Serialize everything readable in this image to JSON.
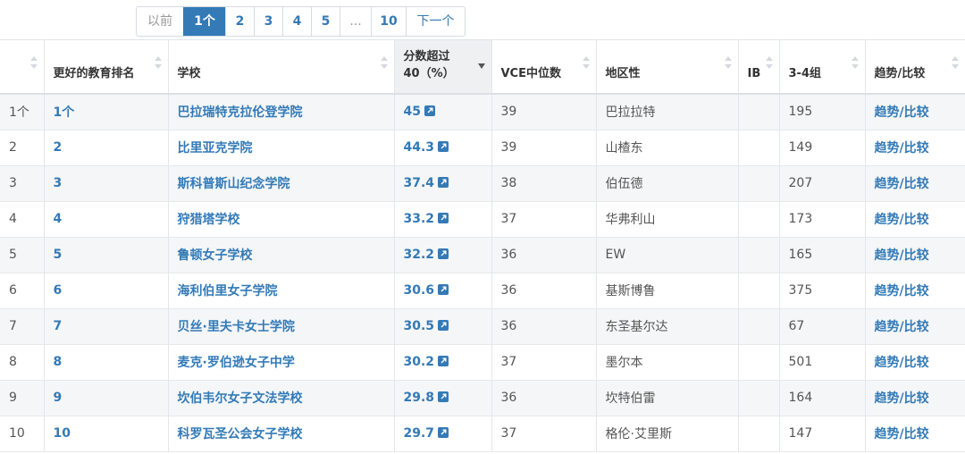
{
  "pagination": {
    "prev": "以前",
    "pages": [
      "1个",
      "2",
      "3",
      "4",
      "5",
      "...",
      "10"
    ],
    "active_index": 0,
    "next": "下一个"
  },
  "table": {
    "headers": [
      "",
      "更好的教育排名",
      "学校",
      "分数超过\n40（%）",
      "VCE中位数",
      "地区性",
      "IB",
      "3-4组",
      "趋势/比较"
    ],
    "rows": [
      [
        "1个",
        "1个",
        "巴拉瑞特克拉伦登学院",
        "45",
        "39",
        "巴拉拉特",
        "",
        "195",
        "趋势/比较"
      ],
      [
        "2",
        "2",
        "比里亚克学院",
        "44.3",
        "39",
        "山楂东",
        "",
        "149",
        "趋势/比较"
      ],
      [
        "3",
        "3",
        "斯科普斯山纪念学院",
        "37.4",
        "38",
        "伯伍德",
        "",
        "207",
        "趋势/比较"
      ],
      [
        "4",
        "4",
        "狩猎塔学校",
        "33.2",
        "37",
        "华弗利山",
        "",
        "173",
        "趋势/比较"
      ],
      [
        "5",
        "5",
        "鲁顿女子学校",
        "32.2",
        "36",
        "EW",
        "",
        "165",
        "趋势/比较"
      ],
      [
        "6",
        "6",
        "海利伯里女子学院",
        "30.6",
        "36",
        "基斯博鲁",
        "",
        "375",
        "趋势/比较"
      ],
      [
        "7",
        "7",
        "贝丝·里夫卡女士学院",
        "30.5",
        "36",
        "东圣基尔达",
        "",
        "67",
        "趋势/比较"
      ],
      [
        "8",
        "8",
        "麦克·罗伯逊女子中学",
        "30.2",
        "37",
        "墨尔本",
        "",
        "501",
        "趋势/比较"
      ],
      [
        "9",
        "9",
        "坎伯韦尔女子文法学校",
        "29.8",
        "36",
        "坎特伯雷",
        "",
        "164",
        "趋势/比较"
      ],
      [
        "10",
        "10",
        "科罗瓦圣公会女子学校",
        "29.7",
        "37",
        "格伦·艾里斯",
        "",
        "147",
        "趋势/比较"
      ]
    ]
  },
  "colors": {
    "accent": "#337ab7",
    "row_alt": "#f5f6f7",
    "sorted_header": "#eef0f2"
  }
}
